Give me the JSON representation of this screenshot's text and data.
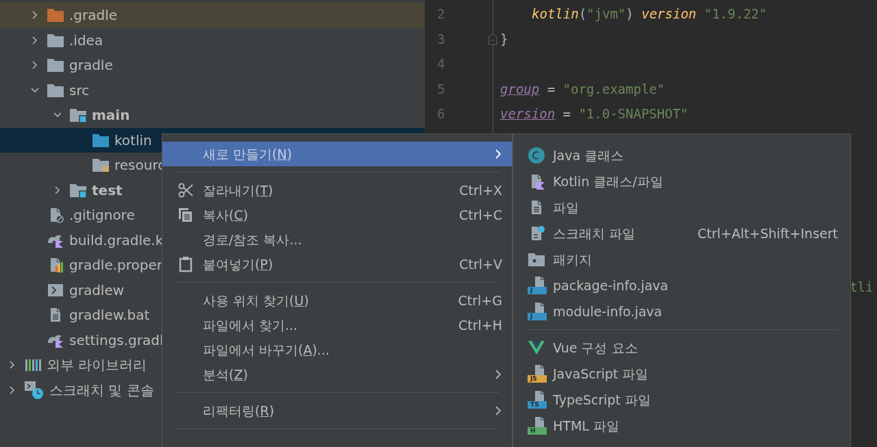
{
  "tree": {
    "project_children": [
      {
        "name": ".gradle",
        "kind": "folder",
        "expanded": false,
        "excluded": true,
        "selected": false
      },
      {
        "name": ".idea",
        "kind": "folder",
        "expanded": false,
        "excluded": false,
        "selected": false
      },
      {
        "name": "gradle",
        "kind": "folder",
        "expanded": false,
        "excluded": false,
        "selected": false
      },
      {
        "name": "src",
        "kind": "folder",
        "expanded": true,
        "excluded": false,
        "selected": false,
        "children": [
          {
            "name": "main",
            "kind": "module-folder",
            "bold": true,
            "expanded": true,
            "excluded": false,
            "selected": false,
            "children": [
              {
                "name": "kotlin",
                "kind": "source-folder",
                "excluded": false,
                "selected": true
              },
              {
                "name": "resourc",
                "kind": "resource-folder",
                "excluded": false,
                "selected": false
              }
            ]
          },
          {
            "name": "test",
            "kind": "module-folder",
            "bold": true,
            "expanded": false,
            "excluded": false,
            "selected": false
          }
        ]
      },
      {
        "name": ".gitignore",
        "kind": "ignore-file",
        "excluded": false,
        "selected": false
      },
      {
        "name": "build.gradle.k",
        "kind": "gradle-kts",
        "excluded": false,
        "selected": false
      },
      {
        "name": "gradle.proper",
        "kind": "properties",
        "excluded": false,
        "selected": false
      },
      {
        "name": "gradlew",
        "kind": "shell",
        "excluded": false,
        "selected": false
      },
      {
        "name": "gradlew.bat",
        "kind": "text-file",
        "excluded": false,
        "selected": false
      },
      {
        "name": "settings.gradl",
        "kind": "gradle-kts",
        "excluded": false,
        "selected": false
      }
    ],
    "top_level": [
      {
        "name": "외부 라이브러리",
        "kind": "libraries",
        "expanded": false,
        "excluded": false,
        "selected": false
      },
      {
        "name": "스크래치 및 콘솔",
        "kind": "scratches",
        "expanded": false,
        "excluded": false,
        "selected": false
      }
    ]
  },
  "editor": {
    "lines": [
      {
        "number": "2",
        "indent": true,
        "tokens": [
          {
            "kind": "fn",
            "text": "kotlin"
          },
          {
            "kind": "plain",
            "text": "("
          },
          {
            "kind": "string",
            "text": "\"jvm\""
          },
          {
            "kind": "plain",
            "text": ") "
          },
          {
            "kind": "fn",
            "text": "version"
          },
          {
            "kind": "string",
            "text": " \"1.9.22\""
          }
        ]
      },
      {
        "number": "3",
        "indent": false,
        "fold": true,
        "tokens": [
          {
            "kind": "plain",
            "text": "}"
          }
        ]
      },
      {
        "number": "4"
      },
      {
        "number": "5",
        "indent": false,
        "tokens": [
          {
            "kind": "prop",
            "text": "group"
          },
          {
            "kind": "plain",
            "text": " = "
          },
          {
            "kind": "string",
            "text": "\"org.example\""
          }
        ]
      },
      {
        "number": "6",
        "indent": false,
        "tokens": [
          {
            "kind": "prop",
            "text": "version"
          },
          {
            "kind": "plain",
            "text": " = "
          },
          {
            "kind": "string",
            "text": "\"1.0-SNAPSHOT\""
          }
        ]
      }
    ],
    "obscured_fragment": "tli"
  },
  "context_menu": {
    "items": [
      {
        "kind": "plain",
        "label": "새로 만들기(",
        "mnemonic": "N",
        "suffix": ")",
        "selected": true,
        "submenu": true
      },
      {
        "kind": "separator"
      },
      {
        "kind": "scissors",
        "label": "잘라내기(",
        "mnemonic": "T",
        "suffix": ")",
        "shortcut": "Ctrl+X",
        "selected": false,
        "submenu": false
      },
      {
        "kind": "copy",
        "label": "복사(",
        "mnemonic": "C",
        "suffix": ")",
        "shortcut": "Ctrl+C",
        "selected": false,
        "submenu": false
      },
      {
        "kind": "plain",
        "label": "경로/참조 복사...",
        "selected": false,
        "submenu": false
      },
      {
        "kind": "clipboard",
        "label": "붙여넣기(",
        "mnemonic": "P",
        "suffix": ")",
        "shortcut": "Ctrl+V",
        "selected": false,
        "submenu": false
      },
      {
        "kind": "separator"
      },
      {
        "kind": "plain",
        "label": "사용 위치 찾기(",
        "mnemonic": "U",
        "suffix": ")",
        "shortcut": "Ctrl+G",
        "selected": false,
        "submenu": false
      },
      {
        "kind": "plain",
        "label": "파일에서 찾기...",
        "shortcut": "Ctrl+H",
        "selected": false,
        "submenu": false
      },
      {
        "kind": "plain",
        "label": "파일에서 바꾸기(",
        "mnemonic": "A",
        "suffix": ")...",
        "selected": false,
        "submenu": false
      },
      {
        "kind": "plain",
        "label": "분석(",
        "mnemonic": "Z",
        "suffix": ")",
        "selected": false,
        "submenu": true
      },
      {
        "kind": "separator"
      },
      {
        "kind": "plain",
        "label": "리팩터링(",
        "mnemonic": "R",
        "suffix": ")",
        "selected": false,
        "submenu": true
      },
      {
        "kind": "separator"
      }
    ]
  },
  "new_submenu": {
    "items": [
      {
        "kind": "java-class",
        "label": "Java 클래스"
      },
      {
        "kind": "kotlin-file",
        "label": "Kotlin 클래스/파일"
      },
      {
        "kind": "file",
        "label": "파일"
      },
      {
        "kind": "scratch-file",
        "label": "스크래치 파일",
        "shortcut": "Ctrl+Alt+Shift+Insert"
      },
      {
        "kind": "package",
        "label": "패키지"
      },
      {
        "kind": "java-file",
        "badge": "J",
        "label": "package-info.java"
      },
      {
        "kind": "java-file",
        "badge": "J",
        "label": "module-info.java"
      },
      {
        "kind": "separator"
      },
      {
        "kind": "vue",
        "label": "Vue 구성 요소"
      },
      {
        "kind": "js-file",
        "badge": "JS",
        "label": "JavaScript 파일"
      },
      {
        "kind": "ts-file",
        "badge": "TS",
        "label": "TypeScript 파일"
      },
      {
        "kind": "html-file",
        "badge": "H",
        "label": "HTML 파일"
      }
    ]
  }
}
